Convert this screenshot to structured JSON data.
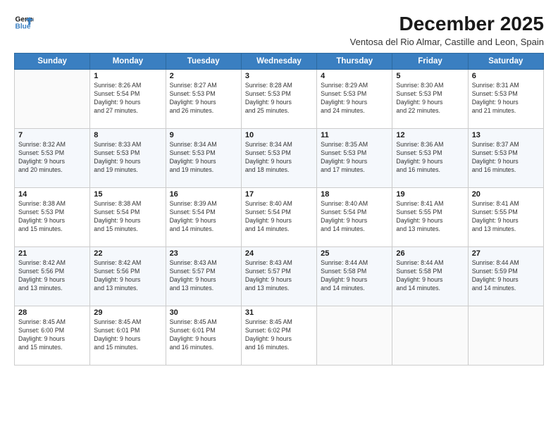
{
  "logo": {
    "line1": "General",
    "line2": "Blue"
  },
  "title": "December 2025",
  "subtitle": "Ventosa del Rio Almar, Castille and Leon, Spain",
  "weekdays": [
    "Sunday",
    "Monday",
    "Tuesday",
    "Wednesday",
    "Thursday",
    "Friday",
    "Saturday"
  ],
  "weeks": [
    [
      {
        "day": "",
        "info": ""
      },
      {
        "day": "1",
        "info": "Sunrise: 8:26 AM\nSunset: 5:54 PM\nDaylight: 9 hours\nand 27 minutes."
      },
      {
        "day": "2",
        "info": "Sunrise: 8:27 AM\nSunset: 5:53 PM\nDaylight: 9 hours\nand 26 minutes."
      },
      {
        "day": "3",
        "info": "Sunrise: 8:28 AM\nSunset: 5:53 PM\nDaylight: 9 hours\nand 25 minutes."
      },
      {
        "day": "4",
        "info": "Sunrise: 8:29 AM\nSunset: 5:53 PM\nDaylight: 9 hours\nand 24 minutes."
      },
      {
        "day": "5",
        "info": "Sunrise: 8:30 AM\nSunset: 5:53 PM\nDaylight: 9 hours\nand 22 minutes."
      },
      {
        "day": "6",
        "info": "Sunrise: 8:31 AM\nSunset: 5:53 PM\nDaylight: 9 hours\nand 21 minutes."
      }
    ],
    [
      {
        "day": "7",
        "info": "Sunrise: 8:32 AM\nSunset: 5:53 PM\nDaylight: 9 hours\nand 20 minutes."
      },
      {
        "day": "8",
        "info": "Sunrise: 8:33 AM\nSunset: 5:53 PM\nDaylight: 9 hours\nand 19 minutes."
      },
      {
        "day": "9",
        "info": "Sunrise: 8:34 AM\nSunset: 5:53 PM\nDaylight: 9 hours\nand 19 minutes."
      },
      {
        "day": "10",
        "info": "Sunrise: 8:34 AM\nSunset: 5:53 PM\nDaylight: 9 hours\nand 18 minutes."
      },
      {
        "day": "11",
        "info": "Sunrise: 8:35 AM\nSunset: 5:53 PM\nDaylight: 9 hours\nand 17 minutes."
      },
      {
        "day": "12",
        "info": "Sunrise: 8:36 AM\nSunset: 5:53 PM\nDaylight: 9 hours\nand 16 minutes."
      },
      {
        "day": "13",
        "info": "Sunrise: 8:37 AM\nSunset: 5:53 PM\nDaylight: 9 hours\nand 16 minutes."
      }
    ],
    [
      {
        "day": "14",
        "info": "Sunrise: 8:38 AM\nSunset: 5:53 PM\nDaylight: 9 hours\nand 15 minutes."
      },
      {
        "day": "15",
        "info": "Sunrise: 8:38 AM\nSunset: 5:54 PM\nDaylight: 9 hours\nand 15 minutes."
      },
      {
        "day": "16",
        "info": "Sunrise: 8:39 AM\nSunset: 5:54 PM\nDaylight: 9 hours\nand 14 minutes."
      },
      {
        "day": "17",
        "info": "Sunrise: 8:40 AM\nSunset: 5:54 PM\nDaylight: 9 hours\nand 14 minutes."
      },
      {
        "day": "18",
        "info": "Sunrise: 8:40 AM\nSunset: 5:54 PM\nDaylight: 9 hours\nand 14 minutes."
      },
      {
        "day": "19",
        "info": "Sunrise: 8:41 AM\nSunset: 5:55 PM\nDaylight: 9 hours\nand 13 minutes."
      },
      {
        "day": "20",
        "info": "Sunrise: 8:41 AM\nSunset: 5:55 PM\nDaylight: 9 hours\nand 13 minutes."
      }
    ],
    [
      {
        "day": "21",
        "info": "Sunrise: 8:42 AM\nSunset: 5:56 PM\nDaylight: 9 hours\nand 13 minutes."
      },
      {
        "day": "22",
        "info": "Sunrise: 8:42 AM\nSunset: 5:56 PM\nDaylight: 9 hours\nand 13 minutes."
      },
      {
        "day": "23",
        "info": "Sunrise: 8:43 AM\nSunset: 5:57 PM\nDaylight: 9 hours\nand 13 minutes."
      },
      {
        "day": "24",
        "info": "Sunrise: 8:43 AM\nSunset: 5:57 PM\nDaylight: 9 hours\nand 13 minutes."
      },
      {
        "day": "25",
        "info": "Sunrise: 8:44 AM\nSunset: 5:58 PM\nDaylight: 9 hours\nand 14 minutes."
      },
      {
        "day": "26",
        "info": "Sunrise: 8:44 AM\nSunset: 5:58 PM\nDaylight: 9 hours\nand 14 minutes."
      },
      {
        "day": "27",
        "info": "Sunrise: 8:44 AM\nSunset: 5:59 PM\nDaylight: 9 hours\nand 14 minutes."
      }
    ],
    [
      {
        "day": "28",
        "info": "Sunrise: 8:45 AM\nSunset: 6:00 PM\nDaylight: 9 hours\nand 15 minutes."
      },
      {
        "day": "29",
        "info": "Sunrise: 8:45 AM\nSunset: 6:01 PM\nDaylight: 9 hours\nand 15 minutes."
      },
      {
        "day": "30",
        "info": "Sunrise: 8:45 AM\nSunset: 6:01 PM\nDaylight: 9 hours\nand 16 minutes."
      },
      {
        "day": "31",
        "info": "Sunrise: 8:45 AM\nSunset: 6:02 PM\nDaylight: 9 hours\nand 16 minutes."
      },
      {
        "day": "",
        "info": ""
      },
      {
        "day": "",
        "info": ""
      },
      {
        "day": "",
        "info": ""
      }
    ]
  ]
}
